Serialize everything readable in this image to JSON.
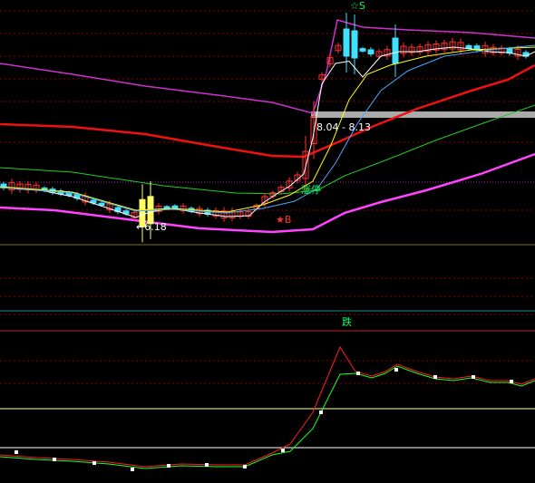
{
  "colors": {
    "background": "#000000",
    "bull": "#ff3030",
    "bear": "#40e0ff",
    "doji": "#ffffff",
    "ma_fast": "#ffffff",
    "ma_mid": "#ffff00",
    "ma_slow": "#4aa8ff",
    "band_upper": "#cc33cc",
    "band_lower": "#ff44ff",
    "band_mid": "#22cc22",
    "long_ma": "#ee1111",
    "dotted_grid": "#8b0000",
    "sub_red_line": "#ff2020",
    "sub_green_line": "#22ff22",
    "sub_marker": "#ffffff",
    "label_green": "#00ff66",
    "label_red": "#ff3030",
    "label_white": "#ffffff"
  },
  "annotations": {
    "sell_signal": "☆S",
    "buy_signal": "★B",
    "low_price": "←6.18",
    "gap_range": "8.04 - 8.13",
    "limit_up_tag": "涨停",
    "fall_tag": "跌"
  },
  "chart_data": [
    {
      "type": "candlestick",
      "title": "",
      "series": [
        {
          "name": "",
          "role": "price_bars"
        },
        {
          "name": "",
          "role": "ma_fast"
        },
        {
          "name": "",
          "role": "ma_mid"
        },
        {
          "name": "",
          "role": "ma_slow"
        },
        {
          "name": "",
          "role": "band_upper"
        },
        {
          "name": "",
          "role": "band_mid"
        },
        {
          "name": "",
          "role": "band_lower"
        },
        {
          "name": "",
          "role": "long_ma"
        }
      ],
      "marked_values": {
        "low": 6.18,
        "gap_low": 8.04,
        "gap_high": 8.13
      },
      "grid": true
    },
    {
      "type": "line",
      "title": "",
      "series": [
        {
          "name": "",
          "role": "oscillator_red"
        },
        {
          "name": "",
          "role": "oscillator_green"
        }
      ],
      "grid": true
    }
  ]
}
